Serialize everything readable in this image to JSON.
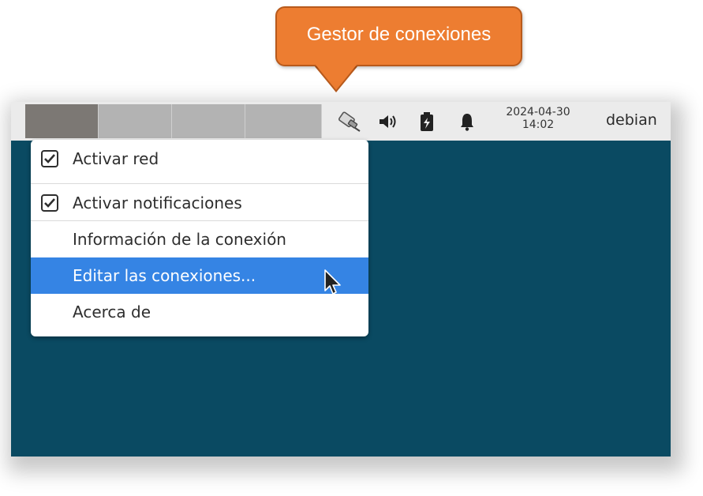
{
  "callout": {
    "text": "Gestor de conexiones"
  },
  "panel": {
    "workspaces": [
      {
        "name": "workspace-1",
        "active": true
      },
      {
        "name": "workspace-2",
        "active": false
      },
      {
        "name": "workspace-3",
        "active": false
      },
      {
        "name": "workspace-4",
        "active": false
      }
    ],
    "tray": {
      "network_icon": "network-manager-icon",
      "volume_icon": "volume-icon",
      "battery_icon": "battery-icon",
      "notification_icon": "bell-icon"
    },
    "clock": {
      "date": "2024-04-30",
      "time": "14:02"
    },
    "user": "debian"
  },
  "menu": {
    "items": [
      {
        "label": "Activar red",
        "checked": true,
        "selected": false
      },
      {
        "label": "Activar notificaciones",
        "checked": true,
        "selected": false
      },
      {
        "label": "Información de la conexión",
        "checked": null,
        "selected": false
      },
      {
        "label": "Editar las conexiones...",
        "checked": null,
        "selected": true
      },
      {
        "label": "Acerca de",
        "checked": null,
        "selected": false
      }
    ]
  },
  "colors": {
    "callout": "#ed7d31",
    "desktop": "#0a4a62",
    "panel": "#ebebeb",
    "selection": "#3584e4"
  }
}
